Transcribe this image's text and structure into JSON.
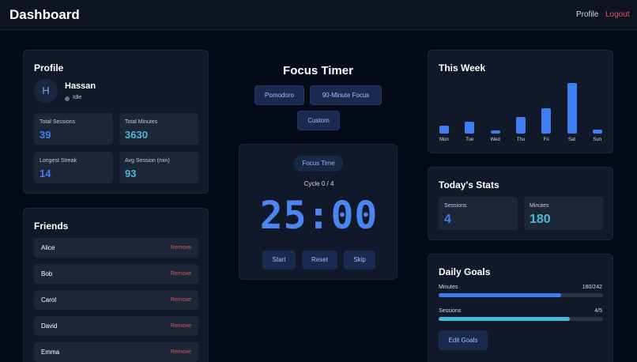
{
  "header": {
    "brand": "Dashboard",
    "nav_profile": "Profile",
    "nav_logout": "Logout"
  },
  "profile": {
    "title": "Profile",
    "avatar_initial": "H",
    "username": "Hassan",
    "status": "Idle",
    "stats": [
      {
        "label": "Total Sessions",
        "value": "39"
      },
      {
        "label": "Total Minutes",
        "value": "3630"
      },
      {
        "label": "Longest Streak",
        "value": "14"
      },
      {
        "label": "Avg Session (min)",
        "value": "93"
      }
    ]
  },
  "friends": {
    "title": "Friends",
    "remove_label": "Remove",
    "items": [
      "Alice",
      "Bob",
      "Carol",
      "David",
      "Emma"
    ]
  },
  "timer": {
    "title": "Focus Timer",
    "modes": [
      "Pomodoro",
      "90-Minute Focus",
      "Custom"
    ],
    "phase": "Focus Time",
    "cycle": "Cycle 0 / 4",
    "display": "25:00",
    "controls": [
      "Start",
      "Reset",
      "Skip"
    ]
  },
  "week": {
    "title": "This Week",
    "chart_data": {
      "type": "bar",
      "categories": [
        "Mon",
        "Tue",
        "Wed",
        "Thu",
        "Fri",
        "Sat",
        "Sun"
      ],
      "values": [
        16,
        24,
        6,
        33,
        50,
        100,
        8
      ],
      "ylim": [
        0,
        100
      ]
    }
  },
  "today": {
    "title": "Today's Stats",
    "sessions_label": "Sessions",
    "sessions_value": "4",
    "minutes_label": "Minutes",
    "minutes_value": "180"
  },
  "goals": {
    "title": "Daily Goals",
    "minutes_label": "Minutes",
    "minutes_value": "180/242",
    "minutes_fraction": 0.744,
    "sessions_label": "Sessions",
    "sessions_value": "4/5",
    "sessions_fraction": 0.8,
    "edit_label": "Edit Goals"
  },
  "colors": {
    "accent": "#3f7ef0",
    "accent_cyan": "#4cb8d8",
    "danger": "#ef4d5a"
  }
}
